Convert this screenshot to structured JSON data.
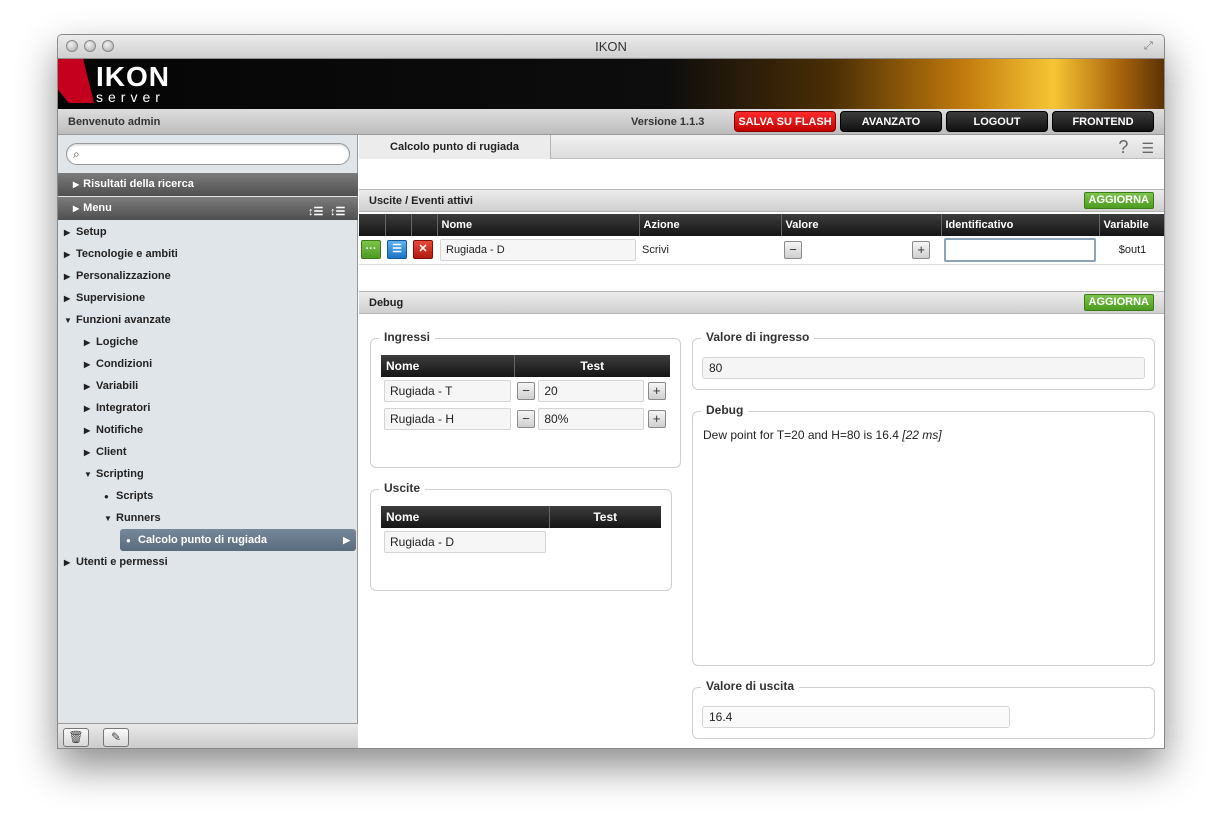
{
  "window": {
    "title": "IKON"
  },
  "logo": {
    "text": "IKON",
    "sub": "server"
  },
  "topbar": {
    "welcome": "Benvenuto admin",
    "version": "Versione 1.1.3",
    "buttons": {
      "flash": "SALVA SU FLASH",
      "advanced": "AVANZATO",
      "logout": "LOGOUT",
      "frontend": "FRONTEND"
    }
  },
  "sidebar": {
    "search": {
      "placeholder": "",
      "value": ""
    },
    "results_header": "Risultati della ricerca",
    "menu_header": "Menu",
    "items": [
      "Setup",
      "Tecnologie e ambiti",
      "Personalizzazione",
      "Supervisione",
      "Funzioni avanzate",
      "Logiche",
      "Condizioni",
      "Variabili",
      "Integratori",
      "Notifiche",
      "Client",
      "Scripting",
      "Scripts",
      "Runners",
      "Calcolo punto di rugiada",
      "Utenti e permessi"
    ]
  },
  "tab": {
    "label": "Calcolo punto di rugiada"
  },
  "outputs_section": {
    "title": "Uscite / Eventi attivi",
    "refresh": "AGGIORNA",
    "columns": [
      "Nome",
      "Azione",
      "Valore",
      "Identificativo",
      "Variabile"
    ],
    "row": {
      "nome": "Rugiada - D",
      "azione": "Scrivi",
      "valore": "",
      "identificativo": "",
      "variabile": "$out1"
    }
  },
  "debug_section": {
    "title": "Debug",
    "refresh": "AGGIORNA",
    "ingressi": {
      "legend": "Ingressi",
      "columns": [
        "Nome",
        "Test"
      ],
      "rows": [
        {
          "nome": "Rugiada - T",
          "test": "20"
        },
        {
          "nome": "Rugiada - H",
          "test": "80%"
        }
      ]
    },
    "uscite": {
      "legend": "Uscite",
      "columns": [
        "Nome",
        "Test"
      ],
      "rows": [
        {
          "nome": "Rugiada - D",
          "test": ""
        }
      ]
    },
    "input_value": {
      "legend": "Valore di ingresso",
      "value": "80"
    },
    "debug": {
      "legend": "Debug",
      "text": "Dew point for T=20 and H=80 is 16.4",
      "timing": "[22 ms]"
    },
    "output_value": {
      "legend": "Valore di uscita",
      "value": "16.4"
    }
  },
  "colors": {
    "accent_green": "#4d9b20",
    "flash_red": "#d40000",
    "selected_nav": "#5a6b7d"
  }
}
